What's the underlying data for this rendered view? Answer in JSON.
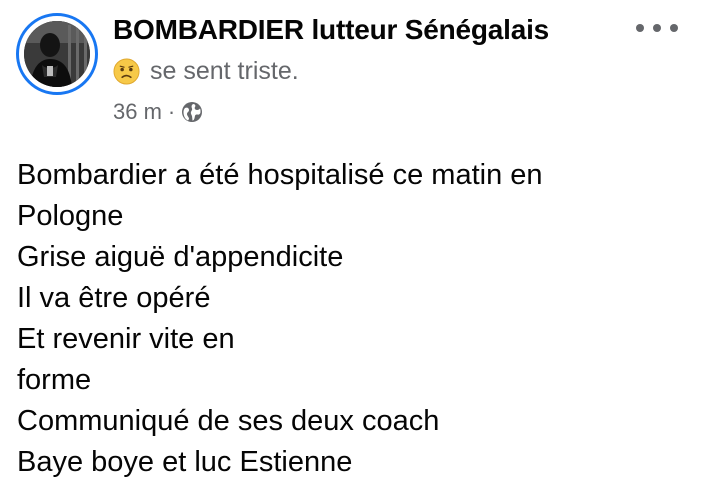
{
  "post": {
    "author": "BOMBARDIER lutteur Sénégalais",
    "feeling_text": "se sent triste.",
    "feeling_icon": "sad-face-emoji-icon",
    "timestamp": "36 m",
    "separator": "·",
    "privacy_icon": "globe-icon",
    "more_icon": "more-options-icon",
    "lines": [
      "Bombardier a été hospitalisé ce matin en",
      "Pologne",
      "Grise aiguë d'appendicite",
      "Il va être opéré",
      "Et revenir vite en",
      "forme",
      "Communiqué de ses deux coach",
      "Baye boye et luc Estienne"
    ]
  },
  "colors": {
    "text_primary": "#050505",
    "text_secondary": "#65676b",
    "story_ring": "#1877f2",
    "emoji_face": "#f7c948"
  }
}
